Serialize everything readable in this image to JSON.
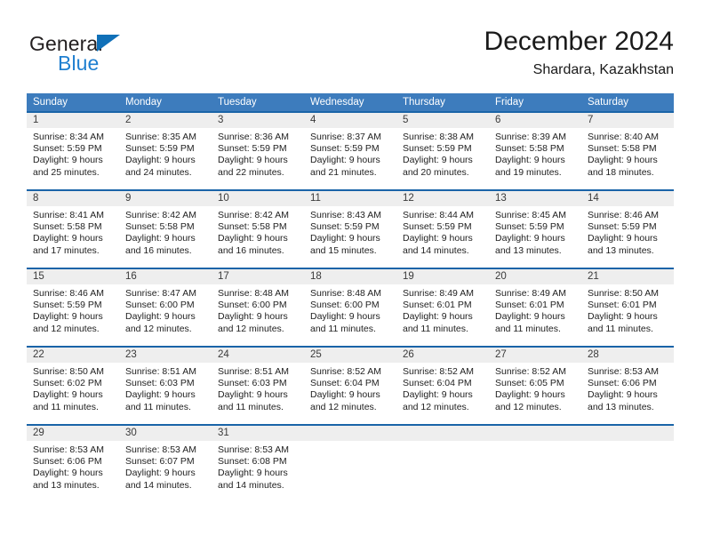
{
  "brand": {
    "name_top": "General",
    "name_bottom": "Blue",
    "accent_color": "#1f7fd0",
    "triangle_color": "#1070b8"
  },
  "header": {
    "title": "December 2024",
    "subtitle": "Shardara, Kazakhstan"
  },
  "theme": {
    "header_bg": "#3d7cbd",
    "row_border": "#1a64a8",
    "daynum_bg": "#eeeeee"
  },
  "calendar": {
    "weekdays": [
      "Sunday",
      "Monday",
      "Tuesday",
      "Wednesday",
      "Thursday",
      "Friday",
      "Saturday"
    ],
    "weeks": [
      [
        {
          "day": "1",
          "sunrise": "Sunrise: 8:34 AM",
          "sunset": "Sunset: 5:59 PM",
          "daylight1": "Daylight: 9 hours",
          "daylight2": "and 25 minutes."
        },
        {
          "day": "2",
          "sunrise": "Sunrise: 8:35 AM",
          "sunset": "Sunset: 5:59 PM",
          "daylight1": "Daylight: 9 hours",
          "daylight2": "and 24 minutes."
        },
        {
          "day": "3",
          "sunrise": "Sunrise: 8:36 AM",
          "sunset": "Sunset: 5:59 PM",
          "daylight1": "Daylight: 9 hours",
          "daylight2": "and 22 minutes."
        },
        {
          "day": "4",
          "sunrise": "Sunrise: 8:37 AM",
          "sunset": "Sunset: 5:59 PM",
          "daylight1": "Daylight: 9 hours",
          "daylight2": "and 21 minutes."
        },
        {
          "day": "5",
          "sunrise": "Sunrise: 8:38 AM",
          "sunset": "Sunset: 5:59 PM",
          "daylight1": "Daylight: 9 hours",
          "daylight2": "and 20 minutes."
        },
        {
          "day": "6",
          "sunrise": "Sunrise: 8:39 AM",
          "sunset": "Sunset: 5:58 PM",
          "daylight1": "Daylight: 9 hours",
          "daylight2": "and 19 minutes."
        },
        {
          "day": "7",
          "sunrise": "Sunrise: 8:40 AM",
          "sunset": "Sunset: 5:58 PM",
          "daylight1": "Daylight: 9 hours",
          "daylight2": "and 18 minutes."
        }
      ],
      [
        {
          "day": "8",
          "sunrise": "Sunrise: 8:41 AM",
          "sunset": "Sunset: 5:58 PM",
          "daylight1": "Daylight: 9 hours",
          "daylight2": "and 17 minutes."
        },
        {
          "day": "9",
          "sunrise": "Sunrise: 8:42 AM",
          "sunset": "Sunset: 5:58 PM",
          "daylight1": "Daylight: 9 hours",
          "daylight2": "and 16 minutes."
        },
        {
          "day": "10",
          "sunrise": "Sunrise: 8:42 AM",
          "sunset": "Sunset: 5:58 PM",
          "daylight1": "Daylight: 9 hours",
          "daylight2": "and 16 minutes."
        },
        {
          "day": "11",
          "sunrise": "Sunrise: 8:43 AM",
          "sunset": "Sunset: 5:59 PM",
          "daylight1": "Daylight: 9 hours",
          "daylight2": "and 15 minutes."
        },
        {
          "day": "12",
          "sunrise": "Sunrise: 8:44 AM",
          "sunset": "Sunset: 5:59 PM",
          "daylight1": "Daylight: 9 hours",
          "daylight2": "and 14 minutes."
        },
        {
          "day": "13",
          "sunrise": "Sunrise: 8:45 AM",
          "sunset": "Sunset: 5:59 PM",
          "daylight1": "Daylight: 9 hours",
          "daylight2": "and 13 minutes."
        },
        {
          "day": "14",
          "sunrise": "Sunrise: 8:46 AM",
          "sunset": "Sunset: 5:59 PM",
          "daylight1": "Daylight: 9 hours",
          "daylight2": "and 13 minutes."
        }
      ],
      [
        {
          "day": "15",
          "sunrise": "Sunrise: 8:46 AM",
          "sunset": "Sunset: 5:59 PM",
          "daylight1": "Daylight: 9 hours",
          "daylight2": "and 12 minutes."
        },
        {
          "day": "16",
          "sunrise": "Sunrise: 8:47 AM",
          "sunset": "Sunset: 6:00 PM",
          "daylight1": "Daylight: 9 hours",
          "daylight2": "and 12 minutes."
        },
        {
          "day": "17",
          "sunrise": "Sunrise: 8:48 AM",
          "sunset": "Sunset: 6:00 PM",
          "daylight1": "Daylight: 9 hours",
          "daylight2": "and 12 minutes."
        },
        {
          "day": "18",
          "sunrise": "Sunrise: 8:48 AM",
          "sunset": "Sunset: 6:00 PM",
          "daylight1": "Daylight: 9 hours",
          "daylight2": "and 11 minutes."
        },
        {
          "day": "19",
          "sunrise": "Sunrise: 8:49 AM",
          "sunset": "Sunset: 6:01 PM",
          "daylight1": "Daylight: 9 hours",
          "daylight2": "and 11 minutes."
        },
        {
          "day": "20",
          "sunrise": "Sunrise: 8:49 AM",
          "sunset": "Sunset: 6:01 PM",
          "daylight1": "Daylight: 9 hours",
          "daylight2": "and 11 minutes."
        },
        {
          "day": "21",
          "sunrise": "Sunrise: 8:50 AM",
          "sunset": "Sunset: 6:01 PM",
          "daylight1": "Daylight: 9 hours",
          "daylight2": "and 11 minutes."
        }
      ],
      [
        {
          "day": "22",
          "sunrise": "Sunrise: 8:50 AM",
          "sunset": "Sunset: 6:02 PM",
          "daylight1": "Daylight: 9 hours",
          "daylight2": "and 11 minutes."
        },
        {
          "day": "23",
          "sunrise": "Sunrise: 8:51 AM",
          "sunset": "Sunset: 6:03 PM",
          "daylight1": "Daylight: 9 hours",
          "daylight2": "and 11 minutes."
        },
        {
          "day": "24",
          "sunrise": "Sunrise: 8:51 AM",
          "sunset": "Sunset: 6:03 PM",
          "daylight1": "Daylight: 9 hours",
          "daylight2": "and 11 minutes."
        },
        {
          "day": "25",
          "sunrise": "Sunrise: 8:52 AM",
          "sunset": "Sunset: 6:04 PM",
          "daylight1": "Daylight: 9 hours",
          "daylight2": "and 12 minutes."
        },
        {
          "day": "26",
          "sunrise": "Sunrise: 8:52 AM",
          "sunset": "Sunset: 6:04 PM",
          "daylight1": "Daylight: 9 hours",
          "daylight2": "and 12 minutes."
        },
        {
          "day": "27",
          "sunrise": "Sunrise: 8:52 AM",
          "sunset": "Sunset: 6:05 PM",
          "daylight1": "Daylight: 9 hours",
          "daylight2": "and 12 minutes."
        },
        {
          "day": "28",
          "sunrise": "Sunrise: 8:53 AM",
          "sunset": "Sunset: 6:06 PM",
          "daylight1": "Daylight: 9 hours",
          "daylight2": "and 13 minutes."
        }
      ],
      [
        {
          "day": "29",
          "sunrise": "Sunrise: 8:53 AM",
          "sunset": "Sunset: 6:06 PM",
          "daylight1": "Daylight: 9 hours",
          "daylight2": "and 13 minutes."
        },
        {
          "day": "30",
          "sunrise": "Sunrise: 8:53 AM",
          "sunset": "Sunset: 6:07 PM",
          "daylight1": "Daylight: 9 hours",
          "daylight2": "and 14 minutes."
        },
        {
          "day": "31",
          "sunrise": "Sunrise: 8:53 AM",
          "sunset": "Sunset: 6:08 PM",
          "daylight1": "Daylight: 9 hours",
          "daylight2": "and 14 minutes."
        },
        {
          "day": "",
          "sunrise": "",
          "sunset": "",
          "daylight1": "",
          "daylight2": ""
        },
        {
          "day": "",
          "sunrise": "",
          "sunset": "",
          "daylight1": "",
          "daylight2": ""
        },
        {
          "day": "",
          "sunrise": "",
          "sunset": "",
          "daylight1": "",
          "daylight2": ""
        },
        {
          "day": "",
          "sunrise": "",
          "sunset": "",
          "daylight1": "",
          "daylight2": ""
        }
      ]
    ]
  }
}
